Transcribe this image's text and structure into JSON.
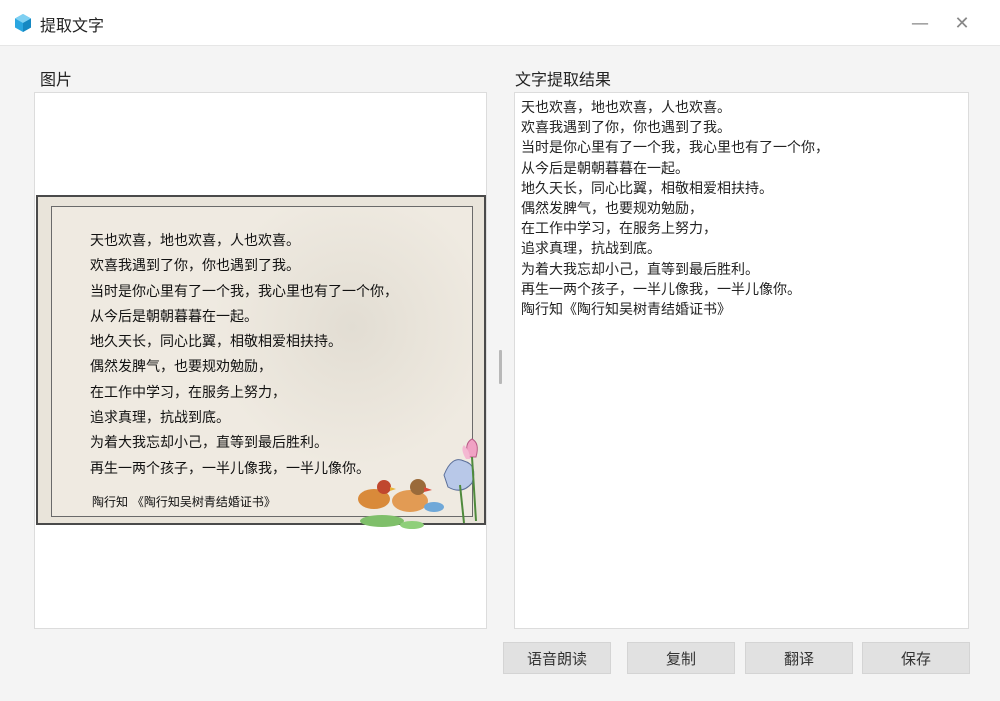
{
  "window": {
    "title": "提取文字",
    "minimize_glyph": "—",
    "close_glyph": "✕",
    "accent_color": "#2aa6e0"
  },
  "image_section": {
    "label": "图片",
    "poem_lines": [
      "天也欢喜，地也欢喜，人也欢喜。",
      "欢喜我遇到了你，你也遇到了我。",
      "当时是你心里有了一个我，我心里也有了一个你，",
      "从今后是朝朝暮暮在一起。",
      "地久天长，同心比翼，相敬相爱相扶持。",
      "偶然发脾气，也要规劝勉励，",
      "在工作中学习，在服务上努力，",
      "追求真理，抗战到底。",
      "为着大我忘却小己，直等到最后胜利。",
      "再生一两个孩子，一半儿像我，一半儿像你。"
    ],
    "signature": "陶行知 《陶行知吴树青结婚证书》",
    "decoration_icons": [
      "mandarin-ducks-icon",
      "lotus-icon"
    ]
  },
  "result_section": {
    "label": "文字提取结果",
    "lines": [
      "天也欢喜，地也欢喜，人也欢喜。",
      "欢喜我遇到了你，你也遇到了我。",
      "当时是你心里有了一个我，我心里也有了一个你，",
      "从今后是朝朝暮暮在一起。",
      "地久天长，同心比翼，相敬相爱相扶持。",
      "偶然发脾气，也要规劝勉励，",
      "在工作中学习，在服务上努力，",
      "追求真理，抗战到底。",
      "为着大我忘却小己，直等到最后胜利。",
      "再生一两个孩子，一半儿像我，一半儿像你。",
      "陶行知《陶行知吴树青结婚证书》"
    ]
  },
  "buttons": {
    "speak": "语音朗读",
    "copy": "复制",
    "translate": "翻译",
    "save": "保存"
  }
}
